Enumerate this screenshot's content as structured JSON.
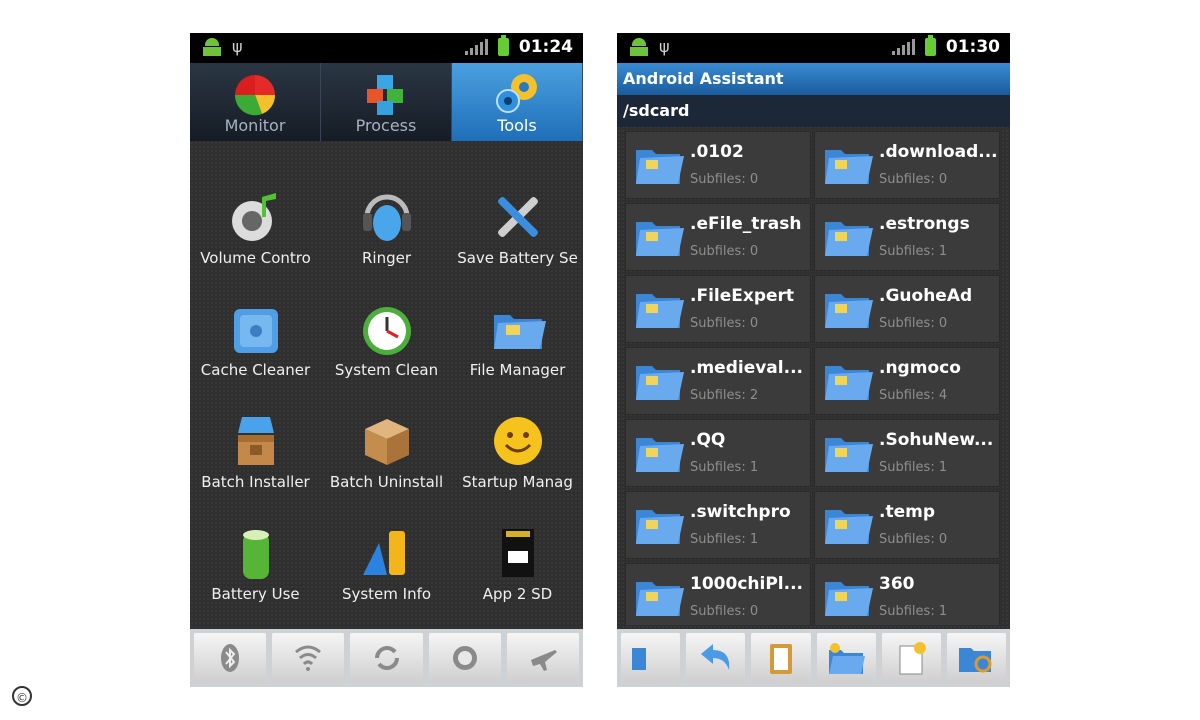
{
  "phone1": {
    "status": {
      "time": "01:24"
    },
    "tabs": [
      {
        "label": "Monitor",
        "icon": "pie-chart-icon",
        "active": false
      },
      {
        "label": "Process",
        "icon": "cubes-icon",
        "active": false
      },
      {
        "label": "Tools",
        "icon": "gears-icon",
        "active": true
      }
    ],
    "tools": [
      {
        "label": "Volume Contro",
        "icon": "volume-control-icon"
      },
      {
        "label": "Ringer",
        "icon": "ringer-icon"
      },
      {
        "label": "Save Battery Se",
        "icon": "wrench-screwdriver-icon"
      },
      {
        "label": "Cache Cleaner",
        "icon": "cache-cleaner-icon"
      },
      {
        "label": "System Clean",
        "icon": "clock-icon"
      },
      {
        "label": "File Manager",
        "icon": "folder-icon"
      },
      {
        "label": "Batch Installer",
        "icon": "batch-installer-icon"
      },
      {
        "label": "Batch Uninstall",
        "icon": "box-icon"
      },
      {
        "label": "Startup Manag",
        "icon": "smiley-icon"
      },
      {
        "label": "Battery Use",
        "icon": "battery-icon"
      },
      {
        "label": "System Info",
        "icon": "system-info-icon"
      },
      {
        "label": "App 2 SD",
        "icon": "sd-card-icon"
      }
    ],
    "toggles": [
      "bluetooth-icon",
      "wifi-icon",
      "sync-icon",
      "gps-icon",
      "airplane-icon"
    ]
  },
  "phone2": {
    "status": {
      "time": "01:30"
    },
    "app_title": "Android Assistant",
    "path": "/sdcard",
    "files": [
      {
        "name": ".0102",
        "sub": "Subfiles: 0"
      },
      {
        "name": ".download...",
        "sub": "Subfiles: 0"
      },
      {
        "name": ".eFile_trash",
        "sub": "Subfiles: 0"
      },
      {
        "name": ".estrongs",
        "sub": "Subfiles: 1"
      },
      {
        "name": ".FileExpert",
        "sub": "Subfiles: 0"
      },
      {
        "name": ".GuoheAd",
        "sub": "Subfiles: 0"
      },
      {
        "name": ".medieval...",
        "sub": "Subfiles: 2"
      },
      {
        "name": ".ngmoco",
        "sub": "Subfiles: 4"
      },
      {
        "name": ".QQ",
        "sub": "Subfiles: 1"
      },
      {
        "name": ".SohuNew...",
        "sub": "Subfiles: 1"
      },
      {
        "name": ".switchpro",
        "sub": "Subfiles: 1"
      },
      {
        "name": ".temp",
        "sub": "Subfiles: 0"
      },
      {
        "name": "1000chiPl...",
        "sub": "Subfiles: 0"
      },
      {
        "name": "360",
        "sub": "Subfiles: 1"
      }
    ],
    "bottom_tools": [
      "partial-folder-icon",
      "back-arrow-icon",
      "clipboard-icon",
      "new-folder-icon",
      "new-file-icon",
      "search-folder-icon"
    ]
  },
  "copyright_symbol": "©"
}
